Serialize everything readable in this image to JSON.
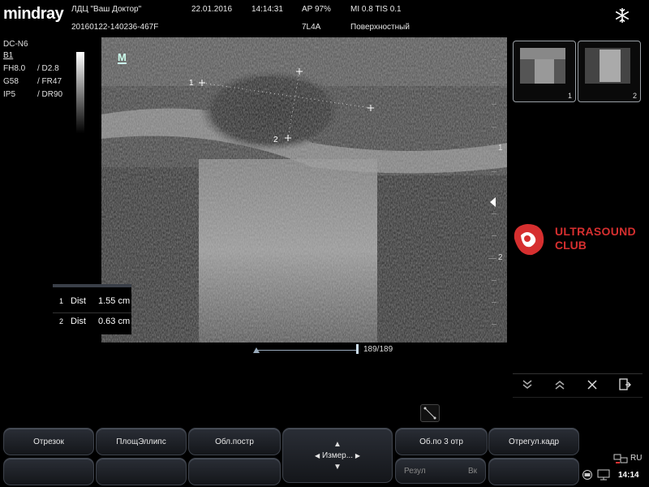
{
  "header": {
    "logo": "mindray",
    "clinic": "ЛДЦ \"Ваш Доктор\"",
    "study_id": "20160122-140236-467F",
    "date": "22.01.2016",
    "time": "14:14:31",
    "ap": "AP  97%",
    "mi_tis": "MI 0.8  TIS 0.1",
    "probe": "7L4A",
    "preset": "Поверхностный"
  },
  "side_params": {
    "model": "DC-N6",
    "mode": "B1",
    "rows": [
      {
        "a": "FH8.0",
        "b": "/ D2.8"
      },
      {
        "a": "G58",
        "b": "/ FR47"
      },
      {
        "a": "IP5",
        "b": "/ DR90"
      }
    ]
  },
  "image": {
    "m_marker": "M",
    "cursor1": "1",
    "cursor2": "2"
  },
  "measurements": [
    {
      "idx": "1",
      "name": "Dist",
      "value": "1.55 cm"
    },
    {
      "idx": "2",
      "name": "Dist",
      "value": "0.63 cm"
    }
  ],
  "depth_labels": [
    "1",
    "2"
  ],
  "cine": {
    "frame": "189/189"
  },
  "thumbnails": [
    {
      "num": "1"
    },
    {
      "num": "2"
    }
  ],
  "brand": {
    "line1": "ULTRASOUND",
    "line2": "CLUB",
    "color": "#d62f2f"
  },
  "buttons_row1": [
    "Отрезок",
    "ПлощЭллипс",
    "Обл.постр",
    "Об.по 3 отр",
    "Отрегул.кадр"
  ],
  "center_control": {
    "label": "Измер..."
  },
  "buttons_row2": {
    "rezul": "Резул",
    "vk": "Вк"
  },
  "status": {
    "lang": "RU",
    "clock": "14:14"
  },
  "icons": [
    "snowflake-icon",
    "chevron-down-double-icon",
    "chevron-up-double-icon",
    "close-icon",
    "export-icon",
    "ruler-icon",
    "printer-icon",
    "monitor-icon",
    "network-icon"
  ]
}
